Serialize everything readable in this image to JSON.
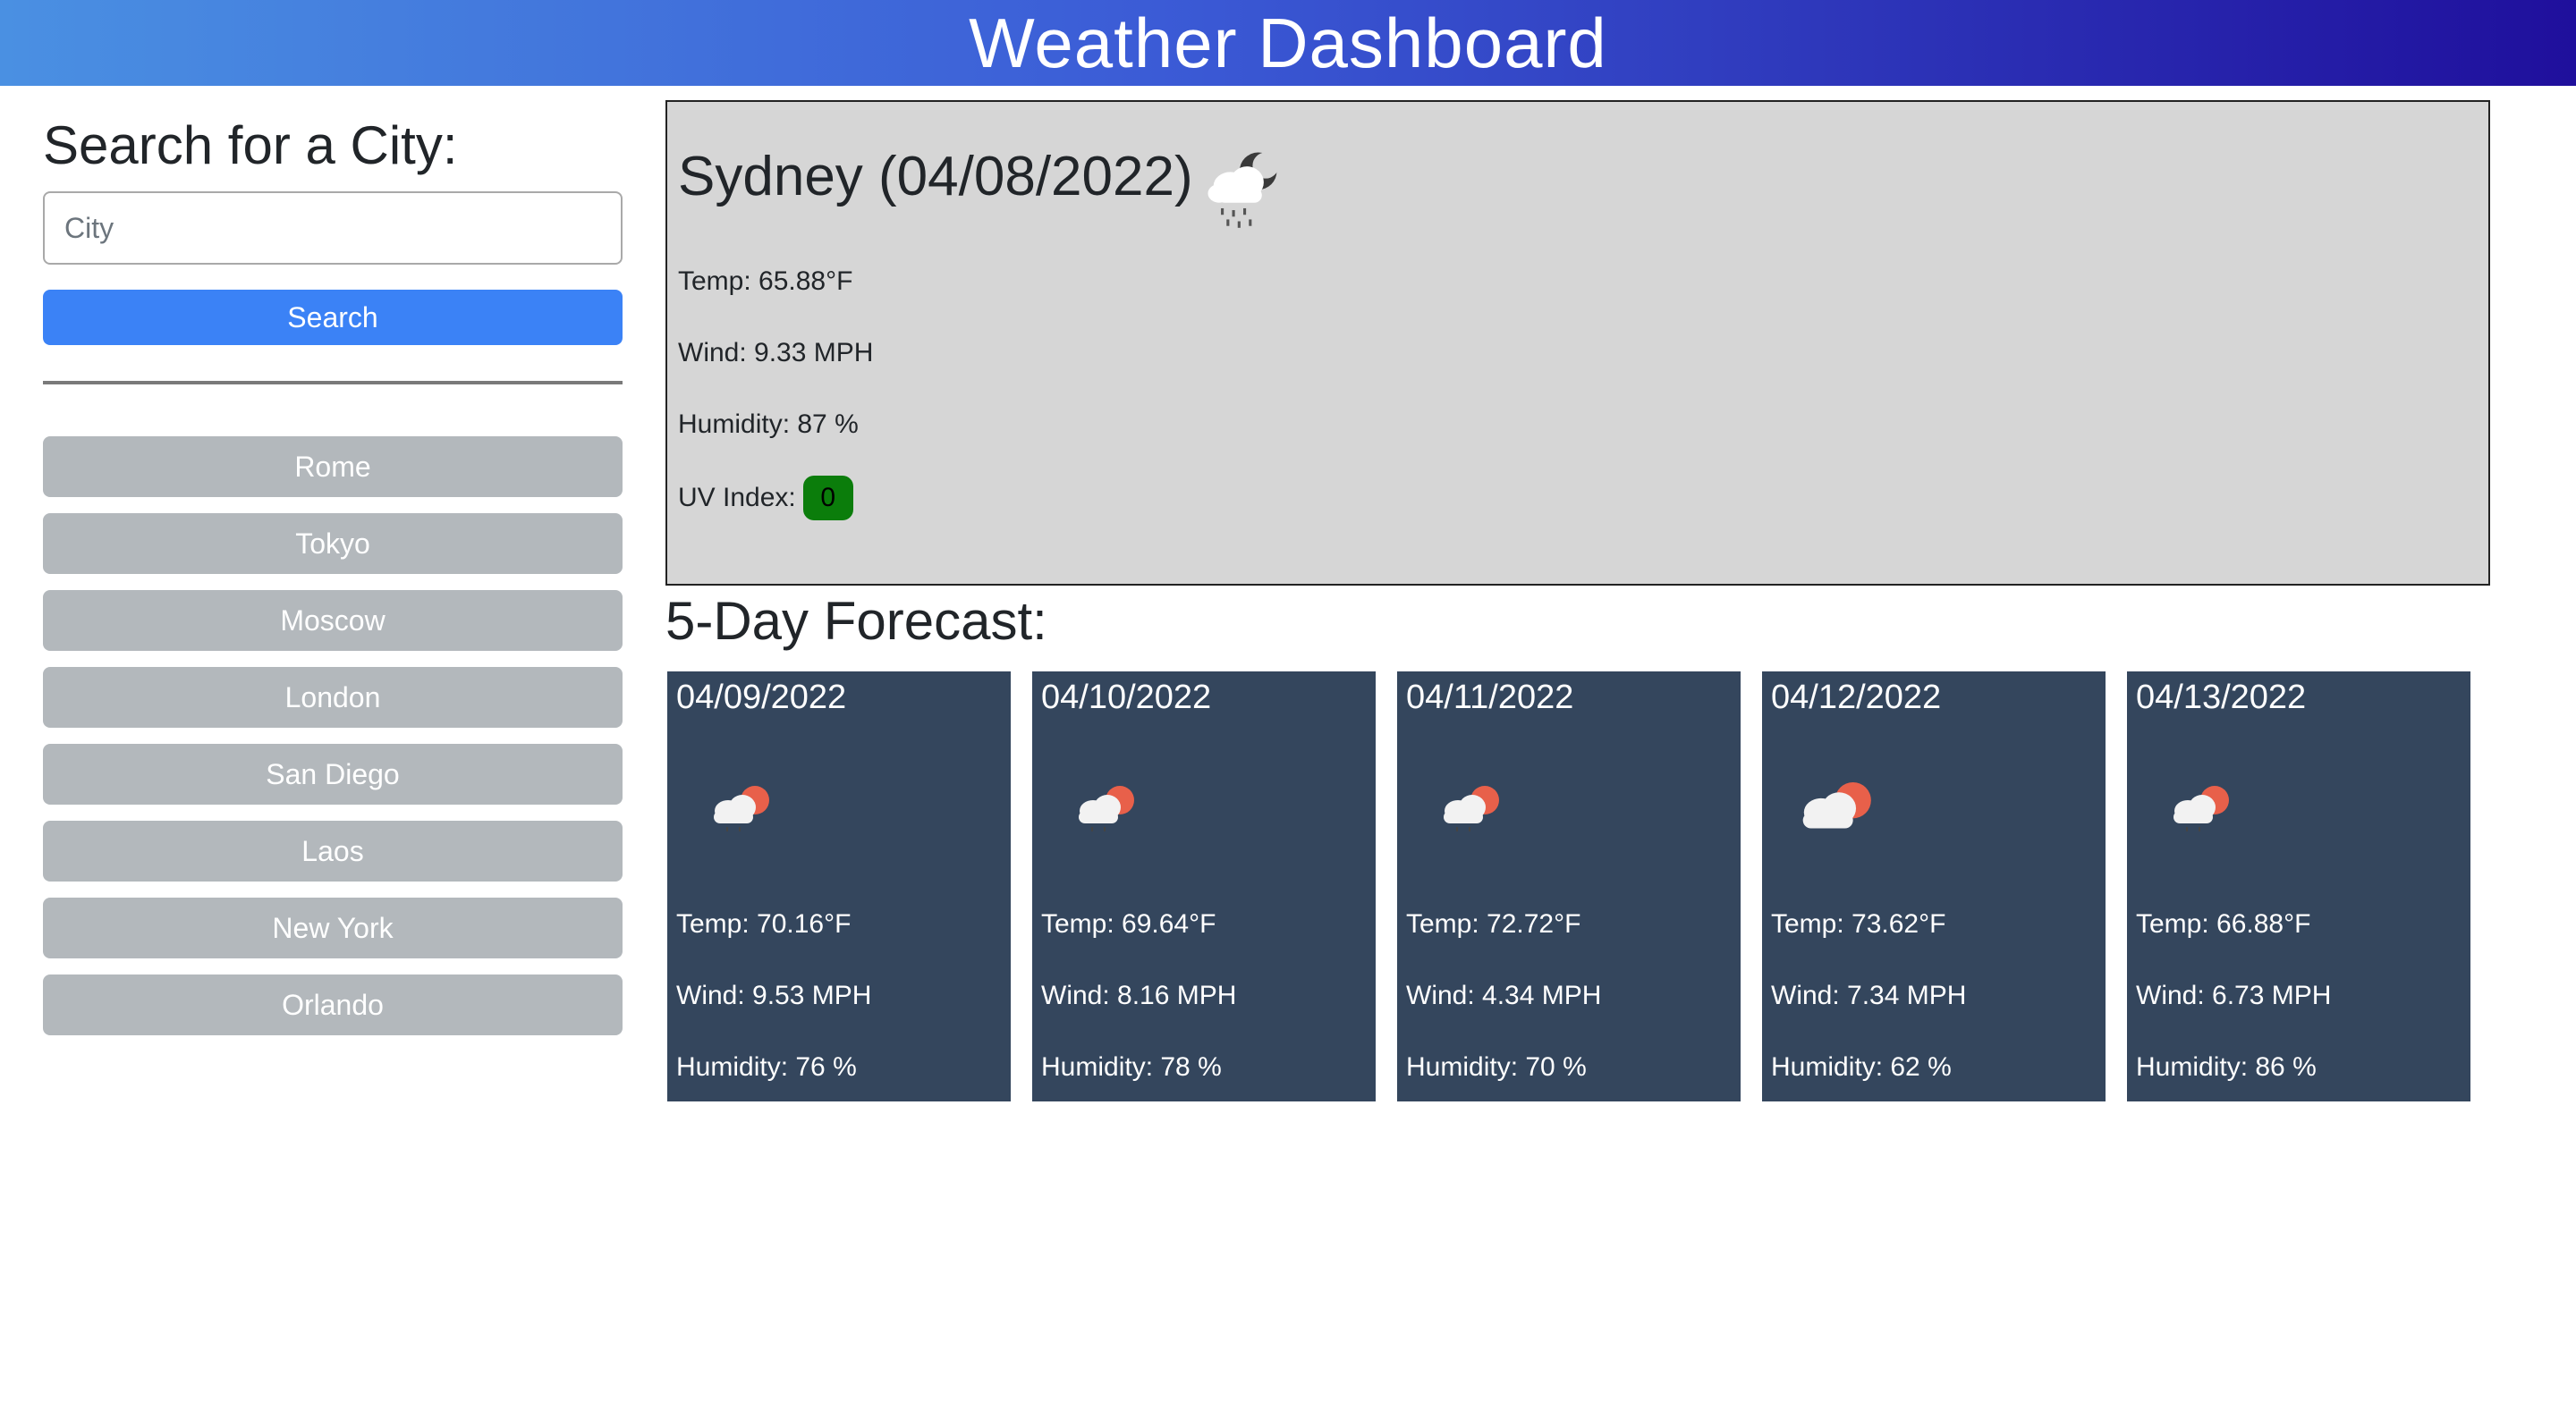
{
  "header": {
    "title": "Weather Dashboard"
  },
  "sidebar": {
    "heading": "Search for a City:",
    "input_placeholder": "City",
    "search_label": "Search",
    "history": [
      "Rome",
      "Tokyo",
      "Moscow",
      "London",
      "San Diego",
      "Laos",
      "New York",
      "Orlando"
    ]
  },
  "current": {
    "title": "Sydney (04/08/2022)",
    "icon": "rain-cloud-night-icon",
    "temp": "Temp: 65.88°F",
    "wind": "Wind: 9.33 MPH",
    "humidity": "Humidity: 87 %",
    "uv_label": "UV Index:",
    "uv_value": "0",
    "uv_color": "#0b7d0b"
  },
  "forecast": {
    "heading": "5-Day Forecast:",
    "days": [
      {
        "date": "04/09/2022",
        "icon": "partly-cloudy-rain-icon",
        "temp": "Temp: 70.16°F",
        "wind": "Wind: 9.53 MPH",
        "humidity": "Humidity: 76 %"
      },
      {
        "date": "04/10/2022",
        "icon": "partly-cloudy-rain-icon",
        "temp": "Temp: 69.64°F",
        "wind": "Wind: 8.16 MPH",
        "humidity": "Humidity: 78 %"
      },
      {
        "date": "04/11/2022",
        "icon": "partly-cloudy-rain-icon",
        "temp": "Temp: 72.72°F",
        "wind": "Wind: 4.34 MPH",
        "humidity": "Humidity: 70 %"
      },
      {
        "date": "04/12/2022",
        "icon": "partly-cloudy-icon",
        "temp": "Temp: 73.62°F",
        "wind": "Wind: 7.34 MPH",
        "humidity": "Humidity: 62 %"
      },
      {
        "date": "04/13/2022",
        "icon": "partly-cloudy-rain-icon",
        "temp": "Temp: 66.88°F",
        "wind": "Wind: 6.73 MPH",
        "humidity": "Humidity: 86 %"
      }
    ]
  },
  "colors": {
    "header_start": "#4a90e2",
    "header_end": "#1f0f9c",
    "search_button": "#3b82f6",
    "history_button": "#b3b8bc",
    "forecast_card": "#34465d",
    "current_panel": "#d6d6d6"
  }
}
